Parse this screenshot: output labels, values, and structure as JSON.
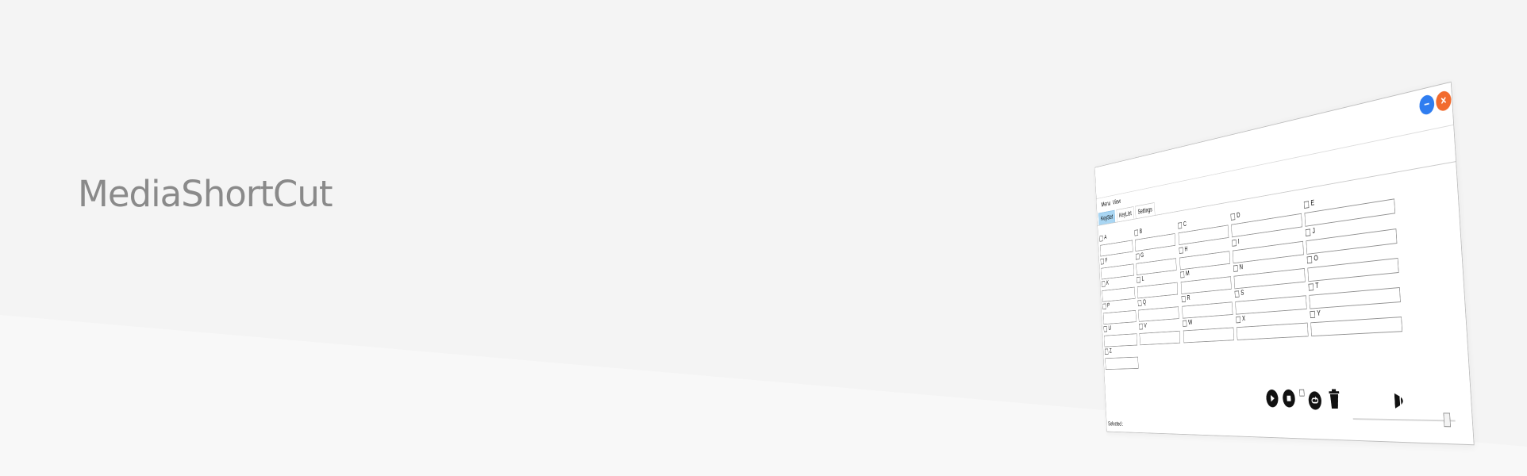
{
  "page": {
    "title": "MediaShortCut",
    "colors": {
      "background": "#f4f4f4",
      "title": "#8a8a8a"
    }
  },
  "window": {
    "buttons": [
      {
        "name": "minimize",
        "icon": "minus-icon",
        "color": "#2f7df0"
      },
      {
        "name": "close",
        "icon": "x-icon",
        "color": "#f26b2e"
      }
    ],
    "menu": [
      "Menu",
      "View"
    ],
    "tabs": [
      {
        "label": "KeySet",
        "active": true
      },
      {
        "label": "KeyList",
        "active": false
      },
      {
        "label": "Settings",
        "active": false
      }
    ],
    "active_tab_color": "#a9d6f3",
    "keys": [
      "A",
      "B",
      "C",
      "D",
      "E",
      "F",
      "G",
      "H",
      "I",
      "J",
      "K",
      "L",
      "M",
      "N",
      "O",
      "P",
      "Q",
      "R",
      "S",
      "T",
      "U",
      "V",
      "W",
      "X",
      "Y",
      "Z"
    ],
    "status_label": "Selected :",
    "controls": {
      "icons": [
        "play-icon",
        "stop-icon",
        "repeat-icon",
        "trash-icon",
        "volume-icon"
      ],
      "repeat_checked": false,
      "volume_level": 0.95
    }
  }
}
